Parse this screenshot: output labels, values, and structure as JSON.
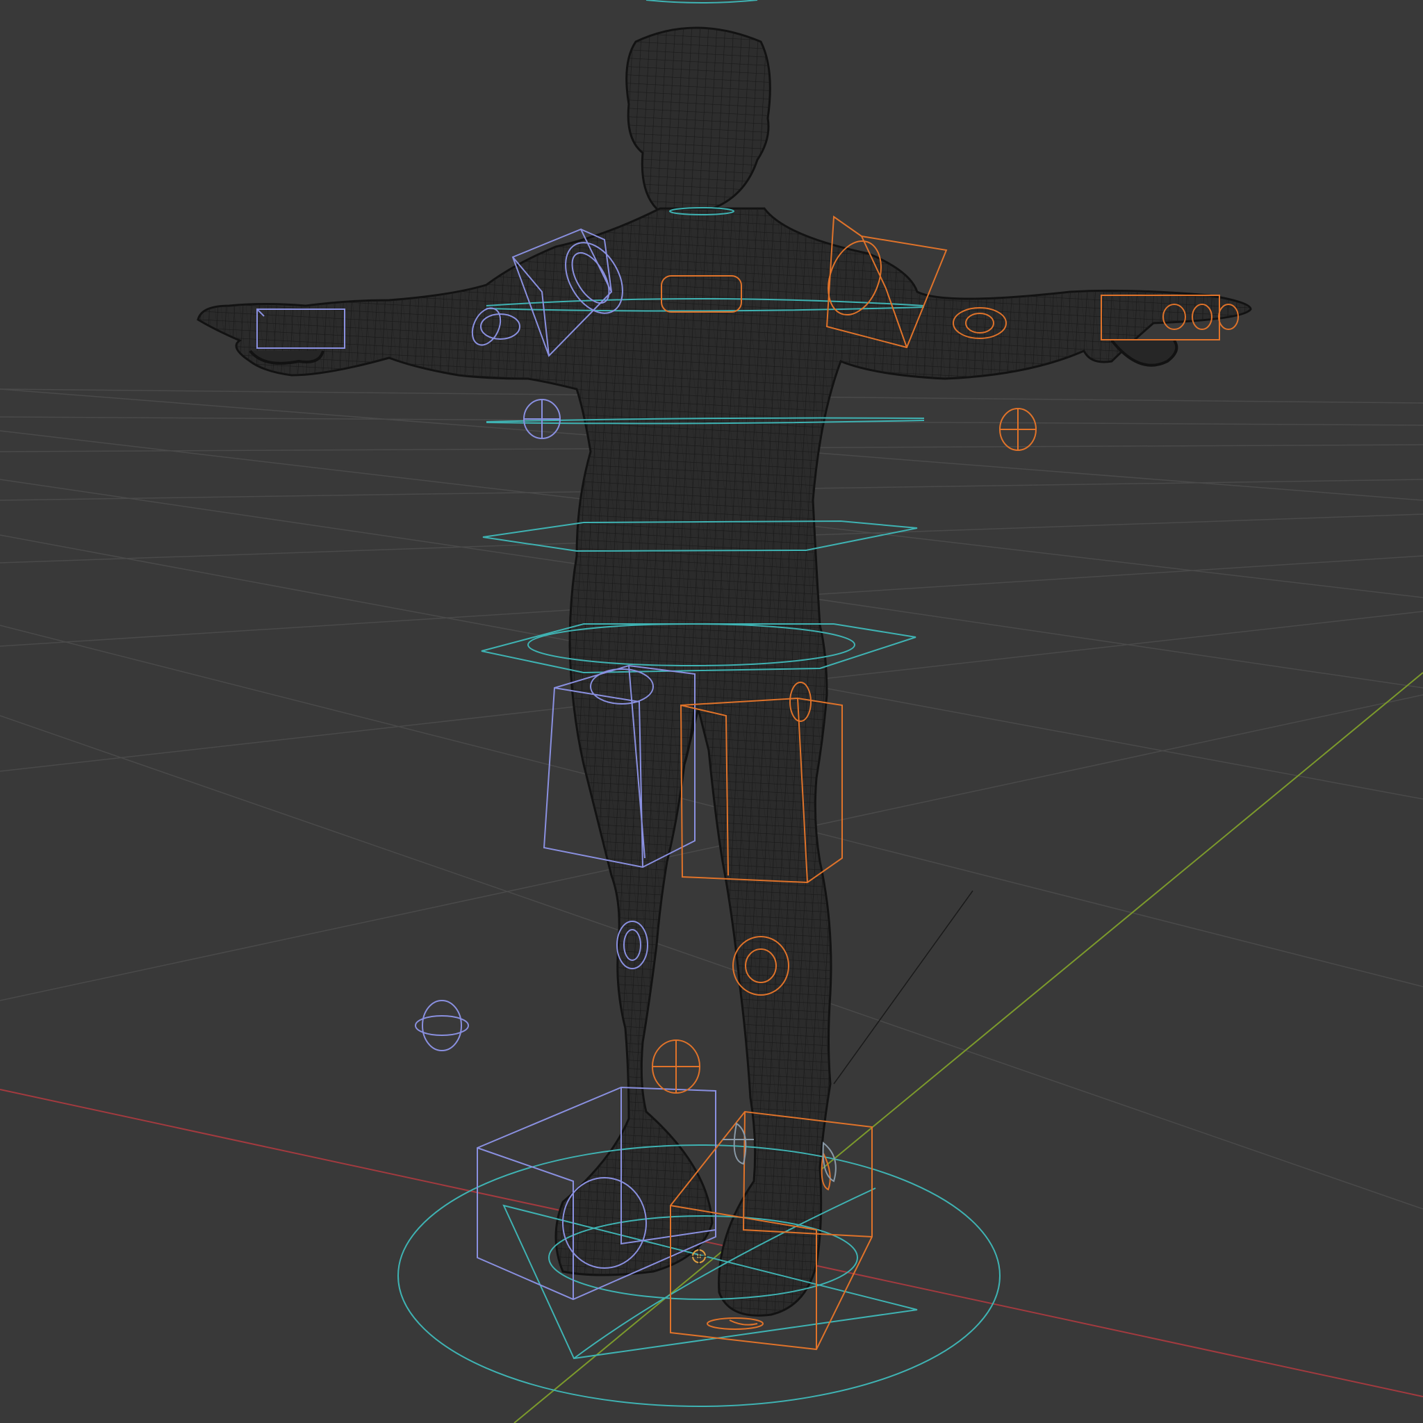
{
  "viewport": {
    "background": "#393939",
    "grid_color": "#4a4a4a",
    "x_axis_color": "#a33a3f",
    "y_axis_color": "#7c9a2c",
    "mesh_color": "#121212",
    "control_left_color": "#8a90e0",
    "control_right_color": "#e0732a",
    "control_center_color": "#3fb3b3",
    "icons": {
      "mesh": "wireframe-mesh-icon",
      "origin": "3d-cursor-icon"
    }
  }
}
